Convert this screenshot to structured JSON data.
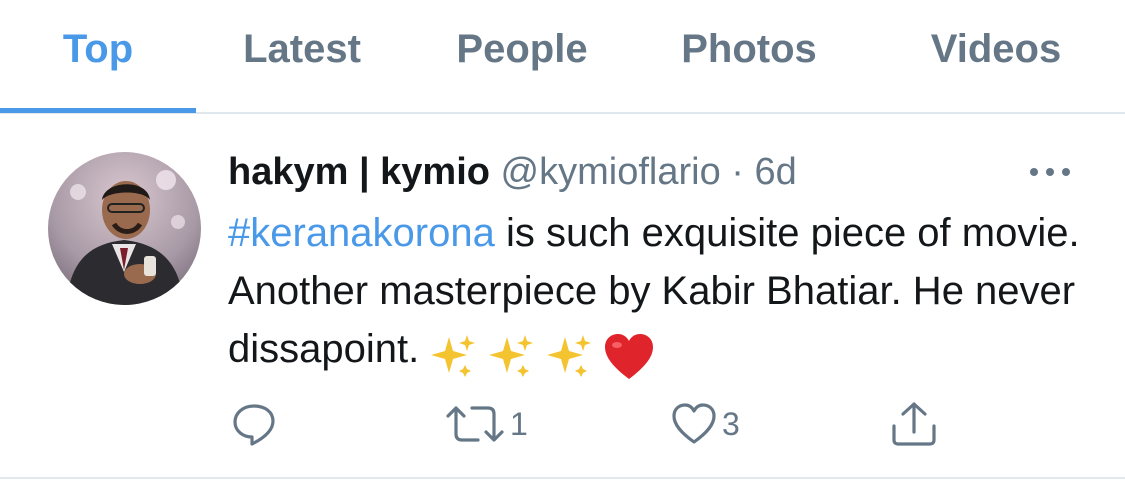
{
  "tabs": [
    {
      "label": "Top",
      "active": true
    },
    {
      "label": "Latest",
      "active": false
    },
    {
      "label": "People",
      "active": false
    },
    {
      "label": "Photos",
      "active": false
    },
    {
      "label": "Videos",
      "active": false
    }
  ],
  "tweet": {
    "display_name": "hakym | kymio",
    "handle": "@kymioflario",
    "separator": "·",
    "time": "6d",
    "hashtag": "#keranakorona",
    "text": " is such exquisite piece of movie. Another masterpiece by Kabir Bhatiar. He never dissapoint.",
    "emojis": [
      "sparkles-icon",
      "sparkles-icon",
      "sparkles-icon",
      "red-heart-icon"
    ],
    "actions": {
      "reply_count": "",
      "retweet_count": "1",
      "like_count": "3"
    }
  },
  "colors": {
    "accent": "#4a99e9",
    "secondary_text": "#657786",
    "divider": "#e1e8ed"
  }
}
